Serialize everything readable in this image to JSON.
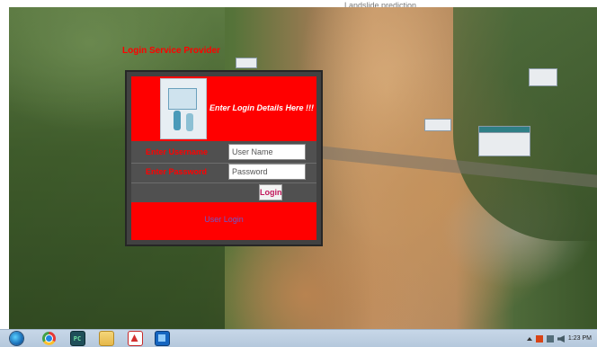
{
  "page": {
    "top_watermark": "Landslide prediction"
  },
  "app": {
    "caption": "Login Service Provider",
    "header_title": "Enter Login Details Here !!!",
    "username_label": "Enter Username",
    "password_label": "Enter Password",
    "username_placeholder": "User Name",
    "password_placeholder": "Password",
    "login_button": "Login",
    "footer_text": "User Login",
    "colors": {
      "panel_red": "#ff0000",
      "frame_gray": "#414141",
      "label_red": "#ff0000",
      "button_text": "#c2185b",
      "footer_text": "#6a5acd"
    }
  },
  "taskbar": {
    "items": [
      {
        "icon": "windows-start-icon"
      },
      {
        "icon": "chrome-icon"
      },
      {
        "icon": "pycharm-icon",
        "glyph": "PC"
      },
      {
        "icon": "folder-icon"
      },
      {
        "icon": "acrobat-icon"
      },
      {
        "icon": "app-window-icon"
      }
    ],
    "tray": {
      "clock_time": "1:23 PM",
      "icons": [
        "show-hidden-icons",
        "flag-icon",
        "network-icon",
        "volume-icon"
      ]
    }
  }
}
